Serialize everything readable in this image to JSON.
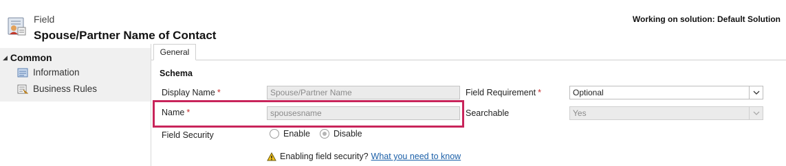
{
  "header": {
    "kicker": "Field",
    "title": "Spouse/Partner Name of Contact",
    "solution": "Working on solution: Default Solution"
  },
  "nav": {
    "section": "Common",
    "items": [
      {
        "label": "Information"
      },
      {
        "label": "Business Rules"
      }
    ]
  },
  "tabs": [
    {
      "label": "General"
    }
  ],
  "schema": {
    "title": "Schema",
    "display_name": {
      "label": "Display Name",
      "required": "*",
      "value": "Spouse/Partner Name"
    },
    "name": {
      "label": "Name",
      "required": "*",
      "value": "spousesname"
    },
    "field_security": {
      "label": "Field Security",
      "options": [
        "Enable",
        "Disable"
      ],
      "selected": "Disable"
    },
    "field_requirement": {
      "label": "Field Requirement",
      "required": "*",
      "value": "Optional"
    },
    "searchable": {
      "label": "Searchable",
      "value": "Yes"
    },
    "warning": {
      "text": "Enabling field security?",
      "link": "What you need to know"
    }
  },
  "colors": {
    "highlight": "#c8245a",
    "required": "#c62828",
    "link": "#1a5fa8"
  }
}
